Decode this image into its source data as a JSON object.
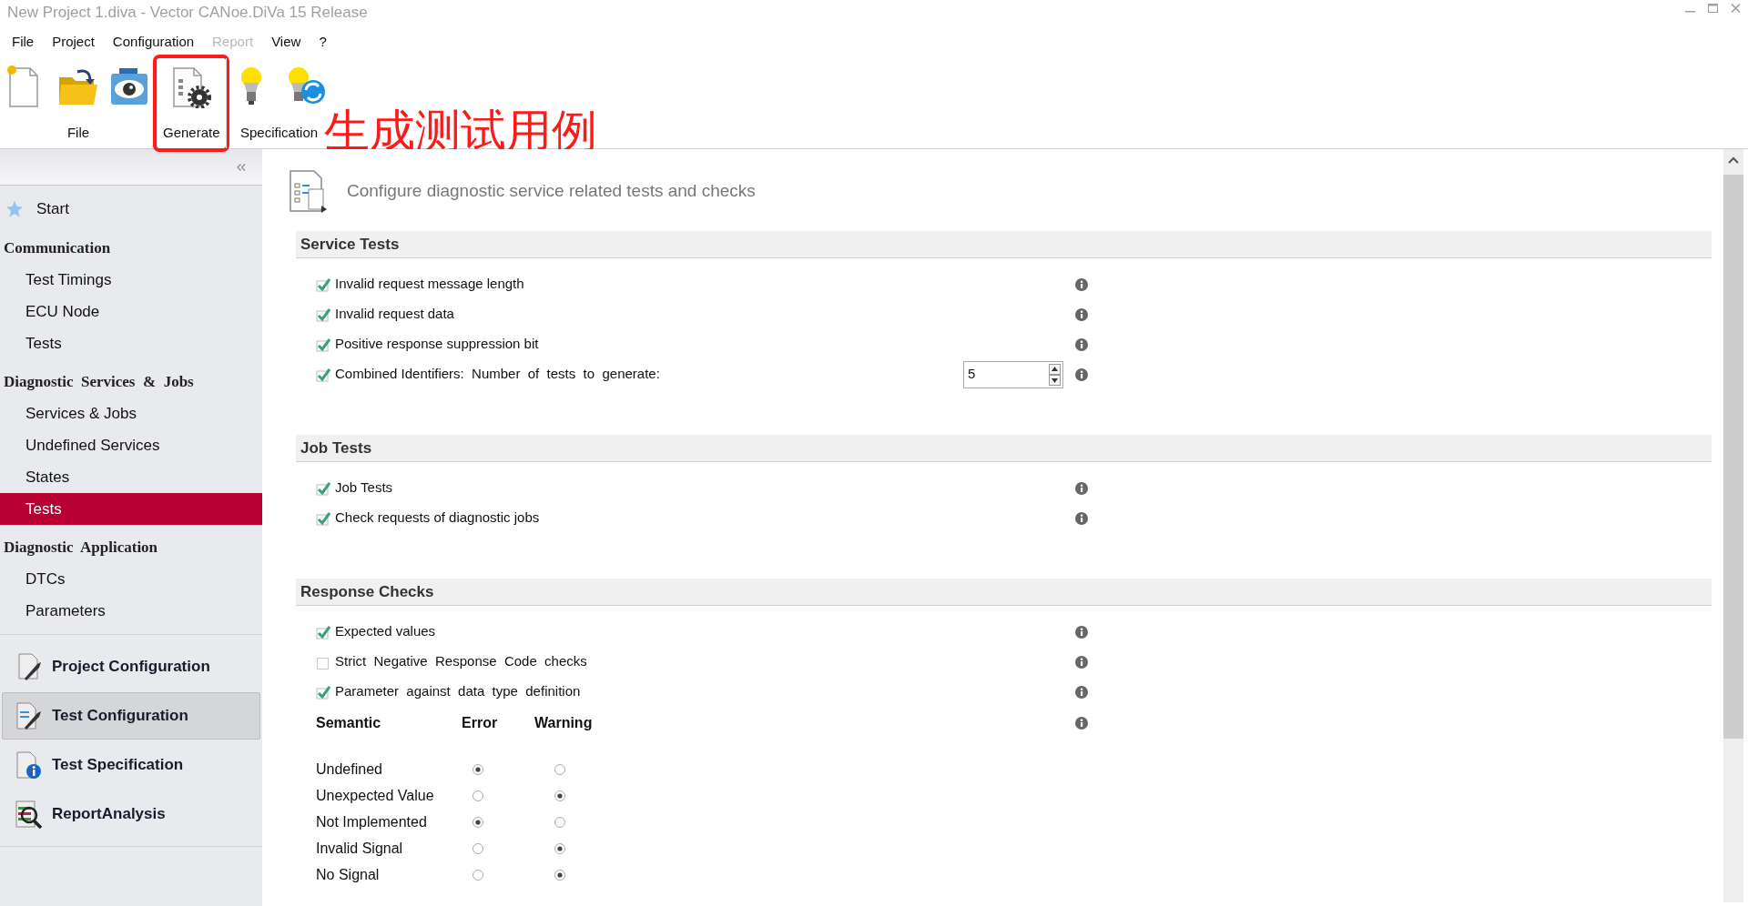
{
  "window": {
    "title": "New Project 1.diva - Vector CANoe.DiVa 15 Release"
  },
  "menu": [
    {
      "label": "File",
      "disabled": false
    },
    {
      "label": "Project",
      "disabled": false
    },
    {
      "label": "Configuration",
      "disabled": false
    },
    {
      "label": "Report",
      "disabled": true
    },
    {
      "label": "View",
      "disabled": false
    },
    {
      "label": "?",
      "disabled": false
    }
  ],
  "toolbar": [
    {
      "label": "File",
      "annotated": false,
      "buttons": [
        {
          "kind": "new"
        },
        {
          "kind": "open"
        },
        {
          "kind": "view"
        }
      ]
    },
    {
      "label": "Generate",
      "annotated": true,
      "buttons": [
        {
          "kind": "generate"
        }
      ]
    },
    {
      "label": "Specification",
      "annotated": false,
      "buttons": [
        {
          "kind": "bulb"
        },
        {
          "kind": "bulb-sync"
        }
      ]
    }
  ],
  "annotation": {
    "text": "生成测试用例"
  },
  "sidebar": {
    "start": {
      "label": "Start"
    },
    "sections": [
      {
        "title": "Communication",
        "items": [
          {
            "label": "Test Timings",
            "selected": false
          },
          {
            "label": "ECU Node",
            "selected": false
          },
          {
            "label": "Tests",
            "selected": false
          }
        ]
      },
      {
        "title": "Diagnostic  Services  &  Jobs",
        "items": [
          {
            "label": "Services & Jobs",
            "selected": false
          },
          {
            "label": "Undefined Services",
            "selected": false
          },
          {
            "label": "States",
            "selected": false
          },
          {
            "label": "Tests",
            "selected": true
          }
        ]
      },
      {
        "title": "Diagnostic  Application",
        "items": [
          {
            "label": "DTCs",
            "selected": false
          },
          {
            "label": "Parameters",
            "selected": false
          }
        ]
      }
    ],
    "nav": [
      {
        "label": "Project Configuration",
        "kind": "project",
        "selected": false
      },
      {
        "label": "Test Configuration",
        "kind": "test-config",
        "selected": true
      },
      {
        "label": "Test Specification",
        "kind": "test-spec",
        "selected": false
      },
      {
        "label": "ReportAnalysis",
        "kind": "report",
        "selected": false
      }
    ]
  },
  "page": {
    "heading": "Configure diagnostic service related tests and checks",
    "groups": [
      {
        "title": "Service Tests",
        "options": [
          {
            "label": "Invalid request message length",
            "checked": true
          },
          {
            "label": "Invalid request data",
            "checked": true
          },
          {
            "label": "Positive response suppression bit",
            "checked": true
          },
          {
            "label": "Combined Identifiers:  Number  of  tests  to  generate:",
            "checked": true,
            "value": "5"
          }
        ]
      },
      {
        "title": "Job Tests",
        "options": [
          {
            "label": "Job Tests",
            "checked": true
          },
          {
            "label": "Check requests of diagnostic jobs",
            "checked": true
          }
        ]
      },
      {
        "title": "Response Checks",
        "options": [
          {
            "label": "Expected values",
            "checked": true
          },
          {
            "label": "Strict  Negative  Response  Code  checks",
            "checked": false
          },
          {
            "label": "Parameter  against  data  type  definition",
            "checked": true
          }
        ],
        "semantic": {
          "columns": [
            "Semantic",
            "Error",
            "Warning"
          ],
          "rows": [
            {
              "label": "Undefined",
              "cells": [
                {
                  "selected": true
                },
                {
                  "selected": false
                }
              ]
            },
            {
              "label": "Unexpected Value",
              "cells": [
                {
                  "selected": false
                },
                {
                  "selected": true
                }
              ]
            },
            {
              "label": "Not Implemented",
              "cells": [
                {
                  "selected": true
                },
                {
                  "selected": false
                }
              ]
            },
            {
              "label": "Invalid Signal",
              "cells": [
                {
                  "selected": false
                },
                {
                  "selected": true
                }
              ]
            },
            {
              "label": "No Signal",
              "cells": [
                {
                  "selected": false
                },
                {
                  "selected": true
                }
              ]
            }
          ]
        }
      }
    ]
  }
}
